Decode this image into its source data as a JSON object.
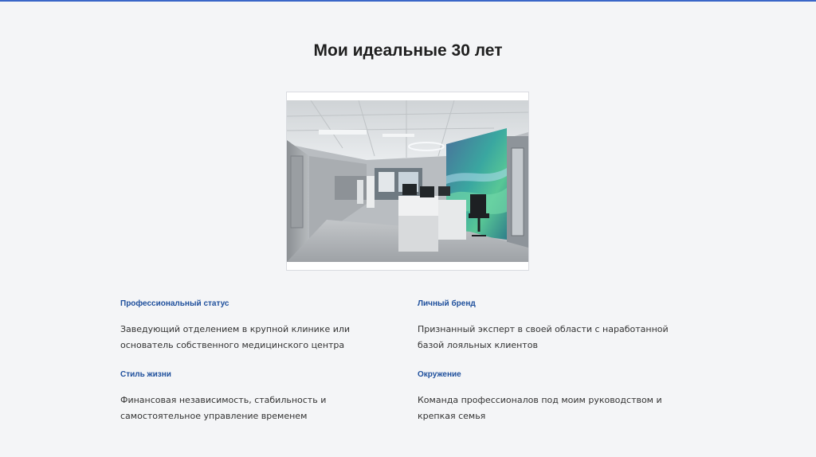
{
  "slide": {
    "title": "Мои идеальные 30 лет"
  },
  "sections": [
    {
      "heading": "Профессиональный статус",
      "text": "Заведующий отделением в крупной клинике или основатель собственного медицинского центра"
    },
    {
      "heading": "Личный бренд",
      "text": "Признанный эксперт в своей области с наработанной базой лояльных клиентов"
    },
    {
      "heading": "Стиль жизни",
      "text": "Финансовая независимость, стабильность и самостоятельное управление временем"
    },
    {
      "heading": "Окружение",
      "text": "Команда профессионалов под моим руководством и крепкая семья"
    }
  ],
  "colors": {
    "accent": "#1e4f9c",
    "top_border": "#3a66c8",
    "background": "#f4f5f7"
  }
}
